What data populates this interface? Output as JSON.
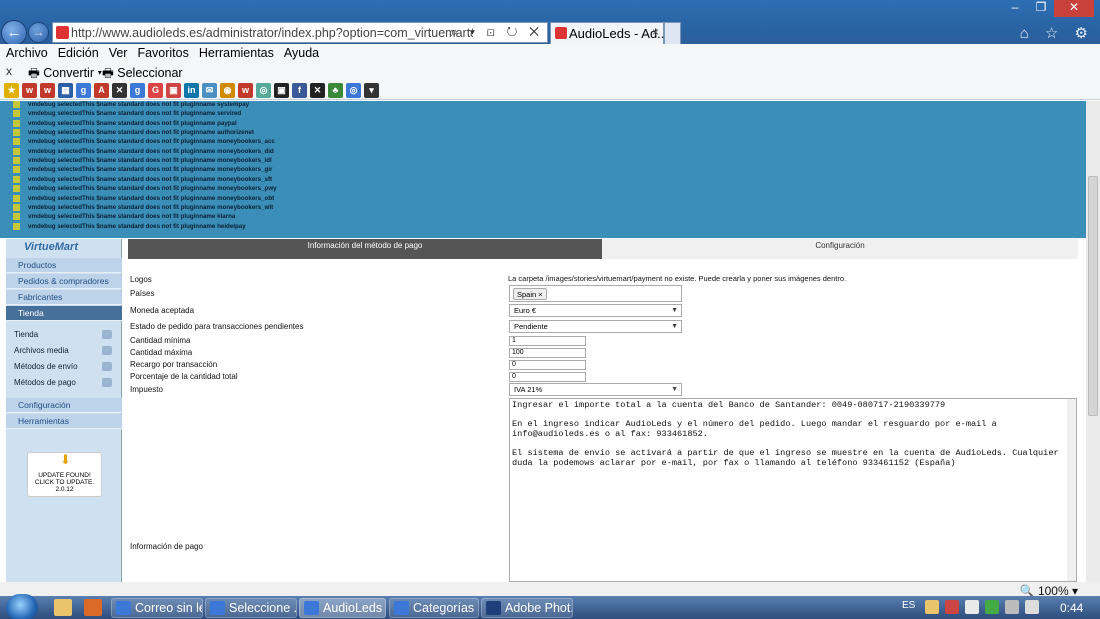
{
  "browser": {
    "url": "http://www.audioleds.es/administrator/index.php?option=com_virtuemart&view=payme",
    "tab_title": "AudioLeds - Ad...",
    "tab_close": "×",
    "back_glyph": "←",
    "forward_glyph": "→",
    "addr_tools": "⌕ ▾ ⊡ ↻ ✕",
    "right_icons": "⌂ ☆ ⚙",
    "win_min": "‒",
    "win_max": "❐",
    "win_close": "✕",
    "zoom": "🔍 100%  ▾"
  },
  "menu": [
    "Archivo",
    "Edición",
    "Ver",
    "Favoritos",
    "Herramientas",
    "Ayuda"
  ],
  "cmdbar": {
    "x": "x",
    "convert": "🖶 Convertir  ▾",
    "select": "🖶 Seleccionar"
  },
  "favorites": [
    {
      "label": "★",
      "color": "#e0b000"
    },
    {
      "label": "w",
      "color": "#c0392b"
    },
    {
      "label": "w",
      "color": "#c0392b"
    },
    {
      "label": "▦",
      "color": "#2b5fa8"
    },
    {
      "label": "g",
      "color": "#3b78d8"
    },
    {
      "label": "A",
      "color": "#c0392b"
    },
    {
      "label": "✕",
      "color": "#333"
    },
    {
      "label": "g",
      "color": "#3b78d8"
    },
    {
      "label": "G",
      "color": "#d44"
    },
    {
      "label": "▣",
      "color": "#c44"
    },
    {
      "label": "in",
      "color": "#0e76a8"
    },
    {
      "label": "✉",
      "color": "#4a90c2"
    },
    {
      "label": "◉",
      "color": "#d08a00"
    },
    {
      "label": "w",
      "color": "#c0392b"
    },
    {
      "label": "◎",
      "color": "#5a9"
    },
    {
      "label": "▣",
      "color": "#222"
    },
    {
      "label": "f",
      "color": "#3b5998"
    },
    {
      "label": "✕",
      "color": "#222"
    },
    {
      "label": "♣",
      "color": "#3a8a3a"
    },
    {
      "label": "◎",
      "color": "#3b78d8"
    },
    {
      "label": "▾",
      "color": "#333"
    }
  ],
  "debug_lines": [
    "vmdebug selectedThis $name standard does not fit pluginname systempay",
    "vmdebug selectedThis $name standard does not fit pluginname servired",
    "vmdebug selectedThis $name standard does not fit pluginname paypal",
    "vmdebug selectedThis $name standard does not fit pluginname authorizenet",
    "vmdebug selectedThis $name standard does not fit pluginname moneybookers_acc",
    "vmdebug selectedThis $name standard does not fit pluginname moneybookers_did",
    "vmdebug selectedThis $name standard does not fit pluginname moneybookers_idl",
    "vmdebug selectedThis $name standard does not fit pluginname moneybookers_gir",
    "vmdebug selectedThis $name standard does not fit pluginname moneybookers_sft",
    "vmdebug selectedThis $name standard does not fit pluginname moneybookers_pwy",
    "vmdebug selectedThis $name standard does not fit pluginname moneybookers_obt",
    "vmdebug selectedThis $name standard does not fit pluginname moneybookers_wlt",
    "vmdebug selectedThis $name standard does not fit pluginname klarna",
    "vmdebug selectedThis $name standard does not fit pluginname heidelpay"
  ],
  "sidebar": {
    "logo": "VirtueMart",
    "sections": [
      "Productos",
      "Pedidos & compradores",
      "Fabricantes",
      "Tienda"
    ],
    "subitems": [
      "Tienda",
      "Archivos media",
      "Métodos de envío",
      "Métodos de pago"
    ],
    "bottom_sections": [
      "Configuración",
      "Herramientas"
    ],
    "update": {
      "icon": "⬇",
      "line1": "UPDATE FOUND!",
      "line2": "CLICK TO UPDATE.",
      "version": "2.0.12"
    }
  },
  "tabs": {
    "info": "Información del método de pago",
    "config": "Configuración"
  },
  "form": {
    "logos_label": "Logos",
    "logos_note": "La carpeta /images/stories/virtuemart/payment no existe. Puede crearla y poner sus imágenes dentro.",
    "paises_label": "Países",
    "paises_value": "Spain",
    "paises_remove": "×",
    "moneda_label": "Moneda aceptada",
    "moneda_value": "Euro €",
    "estado_label": "Estado de pedido para transacciones pendientes",
    "estado_value": "Pendiente",
    "cant_min_label": "Cantidad mínima",
    "cant_min_value": "1",
    "cant_max_label": "Cantidad máxima",
    "cant_max_value": "100",
    "recargo_label": "Recargo por transacción",
    "recargo_value": "0",
    "porcentaje_label": "Porcentaje de la cantidad total",
    "porcentaje_value": "0",
    "impuesto_label": "Impuesto",
    "impuesto_value": "IVA 21%",
    "select_arrow": "▼",
    "info_pago_label": "Información de pago",
    "info_pago_p1": "Ingresar el importe total a la cuenta del Banco de Santander: 0049-080717-2190339779",
    "info_pago_p2": "En el ingreso indicar AudioLeds y el número del pedido. Luego mandar el resguardo por e-mail a info@audioleds.es o al fax: 933461852.",
    "info_pago_p3": "El sistema de envío se activará a partir de que el ingreso se muestre en la cuenta de AudioLeds. Cualquier duda la podemows aclarar por e-mail, por fax o llamando al teléfono 933461152 (España)"
  },
  "taskbar": {
    "tasks": [
      "Correo sin le...",
      "Seleccione ...",
      "AudioLeds -...",
      "Categorías -...",
      "Adobe Phot..."
    ],
    "lang": "ES",
    "clock": "0:44"
  }
}
